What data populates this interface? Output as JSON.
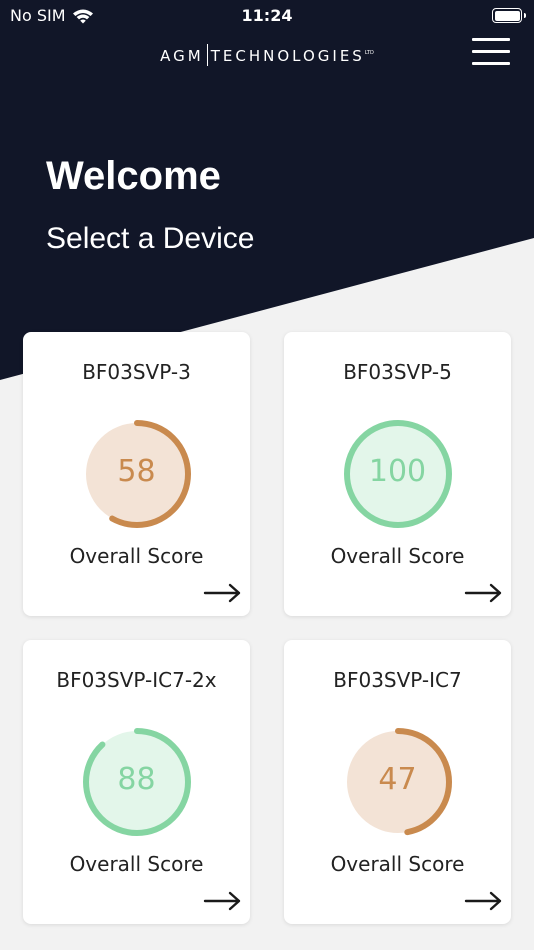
{
  "status_bar": {
    "carrier": "No SIM",
    "time": "11:24",
    "wifi_icon": "wifi-icon",
    "battery_icon": "battery-icon"
  },
  "header": {
    "brand_left": "AGM",
    "brand_right": "TECHNOLOGIES",
    "brand_suffix": "LTD",
    "menu_icon": "hamburger-menu-icon"
  },
  "hero": {
    "title": "Welcome",
    "subtitle": "Select a Device"
  },
  "colors": {
    "header_bg": "#111628",
    "orange": "#c98a4e",
    "orange_fill": "#f3e3d6",
    "green": "#85d5a2",
    "green_fill": "#e3f6ea"
  },
  "devices": [
    {
      "name": "BF03SVP-3",
      "score": "58",
      "score_fraction": 0.58,
      "status": "orange",
      "label": "Overall Score",
      "arrow_icon": "arrow-right-icon"
    },
    {
      "name": "BF03SVP-5",
      "score": "100",
      "score_fraction": 1.0,
      "status": "green",
      "label": "Overall Score",
      "arrow_icon": "arrow-right-icon"
    },
    {
      "name": "BF03SVP-IC7-2x",
      "score": "88",
      "score_fraction": 0.88,
      "status": "green",
      "label": "Overall Score",
      "arrow_icon": "arrow-right-icon"
    },
    {
      "name": "BF03SVP-IC7",
      "score": "47",
      "score_fraction": 0.47,
      "status": "orange",
      "label": "Overall Score",
      "arrow_icon": "arrow-right-icon"
    }
  ]
}
